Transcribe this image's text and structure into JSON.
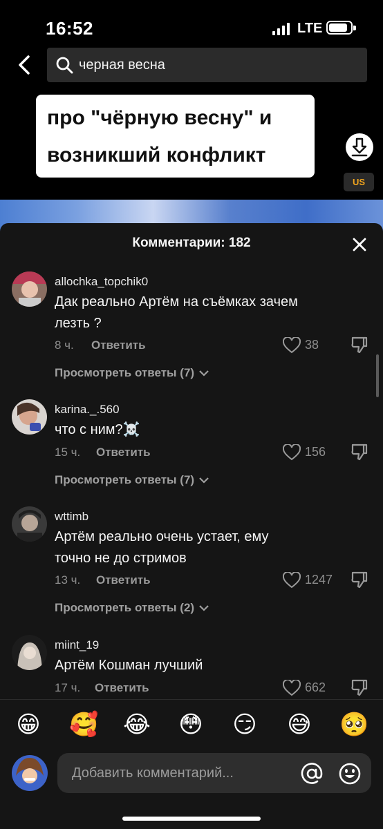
{
  "status_bar": {
    "time": "16:52",
    "network": "LTE"
  },
  "search": {
    "query": "черная весна"
  },
  "video": {
    "title_line1": "про \"чёрную весну\" и",
    "title_line2": "возникший конфликт",
    "region_badge": "US"
  },
  "comments_panel": {
    "title": "Комментарии: 182",
    "reply_label": "Ответить",
    "comments": [
      {
        "username": "allochka_topchik0",
        "text_line1": "Дак реально Артём на съёмках зачем",
        "text_line2": "лезть ?",
        "time": "8 ч.",
        "likes": "38",
        "view_replies": "Просмотреть ответы (7)"
      },
      {
        "username": "karina._.560",
        "text_line1": "что с ним?☠️",
        "time": "15 ч.",
        "likes": "156",
        "view_replies": "Просмотреть ответы (7)"
      },
      {
        "username": "wttimb",
        "text_line1": "Артём реально очень устает, ему",
        "text_line2": "точно не до стримов",
        "time": "13 ч.",
        "likes": "1247",
        "view_replies": "Просмотреть ответы (2)"
      },
      {
        "username": "miint_19",
        "text_line1": "Артём Кошман лучший",
        "time": "17 ч.",
        "likes": "662"
      }
    ]
  },
  "emoji_bar": [
    "😁",
    "🥰",
    "😂",
    "😳",
    "😏",
    "😅",
    "🥺"
  ],
  "input": {
    "placeholder": "Добавить комментарий..."
  },
  "icons": {
    "back": "chevron-left-icon",
    "search": "search-icon",
    "save": "download-icon",
    "close": "close-icon",
    "like": "heart-icon",
    "dislike": "thumbs-down-icon",
    "mention": "at-sign-icon",
    "emoji": "smiley-icon"
  }
}
